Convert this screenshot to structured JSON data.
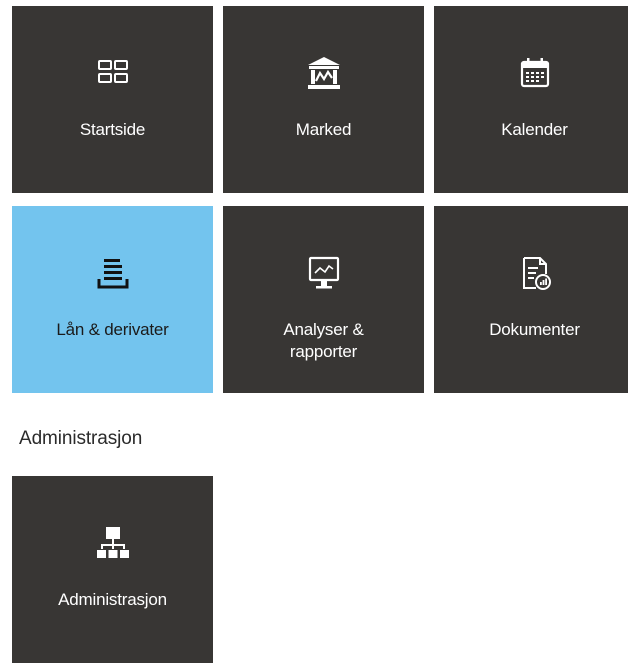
{
  "tiles": {
    "startside": {
      "label": "Startside",
      "icon": "dashboard-icon"
    },
    "marked": {
      "label": "Marked",
      "icon": "market-building-icon"
    },
    "kalender": {
      "label": "Kalender",
      "icon": "calendar-icon"
    },
    "lan": {
      "label": "Lån & derivater",
      "icon": "stacked-list-icon",
      "active": true
    },
    "analyser": {
      "label_line1": "Analyser &",
      "label_line2": "rapporter",
      "icon": "monitor-chart-icon"
    },
    "dokumenter": {
      "label": "Dokumenter",
      "icon": "document-report-icon"
    }
  },
  "admin_section": {
    "heading": "Administrasjon",
    "tile": {
      "label": "Administrasjon",
      "icon": "org-chart-icon"
    }
  },
  "colors": {
    "tile_bg": "#383634",
    "tile_active_bg": "#73c4ee",
    "tile_text": "#ffffff"
  }
}
